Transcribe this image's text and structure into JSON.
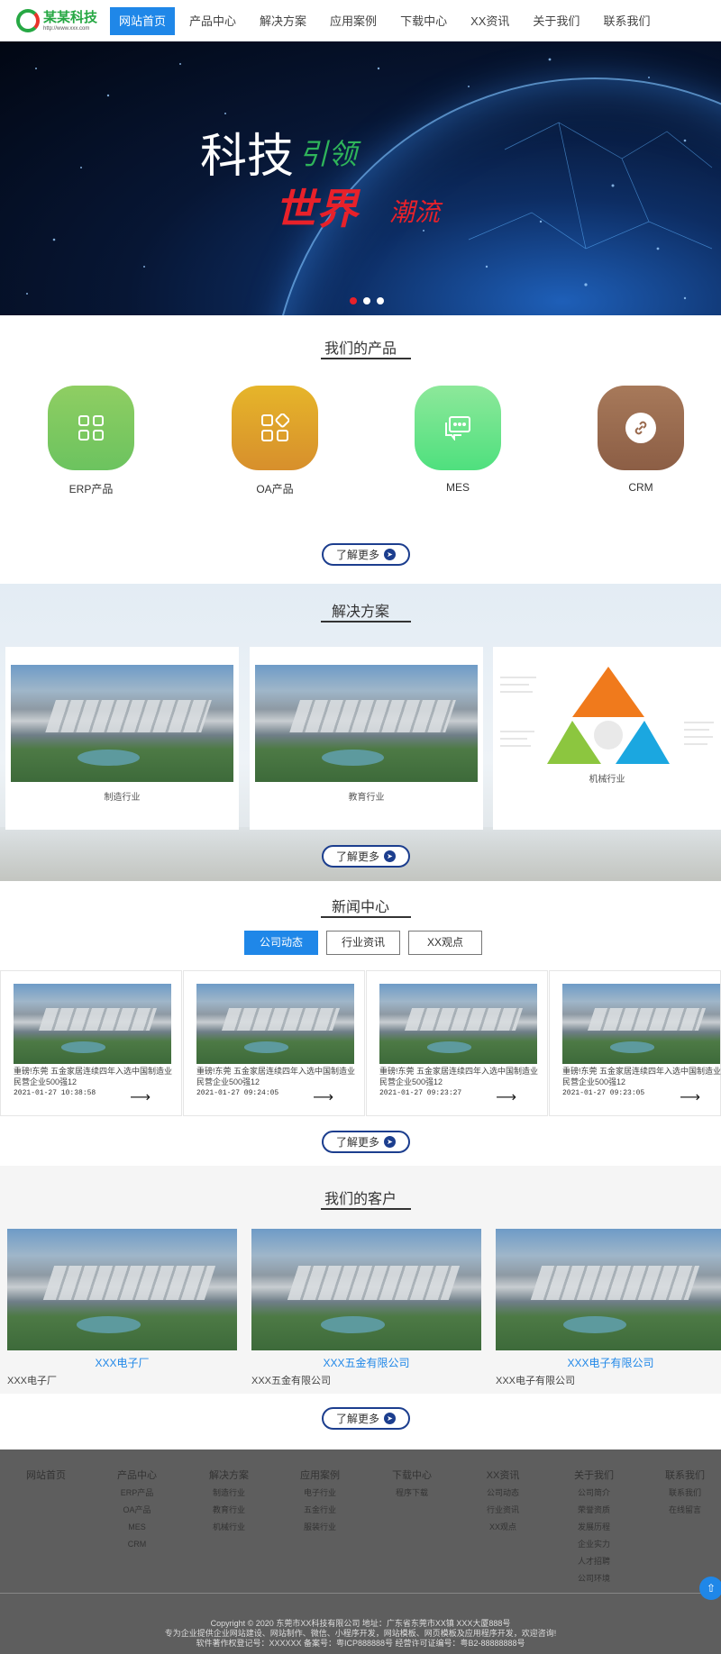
{
  "header": {
    "logo_name": "某某科技",
    "logo_url": "http://www.xxx.com",
    "nav": [
      "网站首页",
      "产品中心",
      "解决方案",
      "应用案例",
      "下载中心",
      "XX资讯",
      "关于我们",
      "联系我们"
    ]
  },
  "banner": {
    "line1": "科技",
    "line1b": "引领",
    "line2": "世界",
    "line2b": "潮流",
    "slides": 3,
    "active_slide": 1
  },
  "products": {
    "title": "我们的产品",
    "items": [
      {
        "label": "ERP产品",
        "icon": "grid-icon",
        "color": "#7cc45e"
      },
      {
        "label": "OA产品",
        "icon": "blocks-icon",
        "color": "#d9a12a"
      },
      {
        "label": "MES",
        "icon": "chat-icon",
        "color": "#5ce08a"
      },
      {
        "label": "CRM",
        "icon": "link-icon",
        "color": "#9a6a4e"
      }
    ],
    "more": "了解更多"
  },
  "solutions": {
    "title": "解决方案",
    "items": [
      {
        "label": "制造行业"
      },
      {
        "label": "教育行业"
      },
      {
        "label": "机械行业"
      }
    ],
    "more": "了解更多"
  },
  "news": {
    "title": "新闻中心",
    "tabs": [
      "公司动态",
      "行业资讯",
      "XX观点"
    ],
    "items": [
      {
        "title": "重磅!东莞 五金家居连续四年入选中国制造业民营企业500强12",
        "date": "2021-01-27 10:38:58"
      },
      {
        "title": "重磅!东莞 五金家居连续四年入选中国制造业民营企业500强12",
        "date": "2021-01-27 09:24:05"
      },
      {
        "title": "重磅!东莞 五金家居连续四年入选中国制造业民营企业500强12",
        "date": "2021-01-27 09:23:27"
      },
      {
        "title": "重磅!东莞 五金家居连续四年入选中国制造业民营企业500强12",
        "date": "2021-01-27 09:23:05"
      }
    ],
    "more": "了解更多"
  },
  "clients": {
    "title": "我们的客户",
    "items": [
      {
        "name": "XXX电子厂",
        "desc": "XXX电子厂"
      },
      {
        "name": "XXX五金有限公司",
        "desc": "XXX五金有限公司"
      },
      {
        "name": "XXX电子有限公司",
        "desc": "XXX电子有限公司"
      }
    ],
    "more": "了解更多"
  },
  "footer": {
    "columns": [
      {
        "title": "网站首页",
        "links": []
      },
      {
        "title": "产品中心",
        "links": [
          "ERP产品",
          "OA产品",
          "MES",
          "CRM"
        ]
      },
      {
        "title": "解决方案",
        "links": [
          "制造行业",
          "教育行业",
          "机械行业"
        ]
      },
      {
        "title": "应用案例",
        "links": [
          "电子行业",
          "五金行业",
          "服装行业"
        ]
      },
      {
        "title": "下载中心",
        "links": [
          "程序下载"
        ]
      },
      {
        "title": "XX资讯",
        "links": [
          "公司动态",
          "行业资讯",
          "XX观点"
        ]
      },
      {
        "title": "关于我们",
        "links": [
          "公司简介",
          "荣誉资质",
          "发展历程",
          "企业实力",
          "人才招聘",
          "公司环境"
        ]
      },
      {
        "title": "联系我们",
        "links": [
          "联系我们",
          "在线留言"
        ]
      }
    ],
    "copyright": "Copyright © 2020 东莞市XX科技有限公司 地址：广东省东莞市XX镇 XXX大厦888号",
    "line2": "专为企业提供企业网站建设、网站制作、微信、小程序开发，网站模板、网页模板及应用程序开发，欢迎咨询!",
    "line3": "软件著作权登记号：XXXXXX 备案号：粤ICP888888号 经营许可证编号：粤B2-88888888号"
  }
}
